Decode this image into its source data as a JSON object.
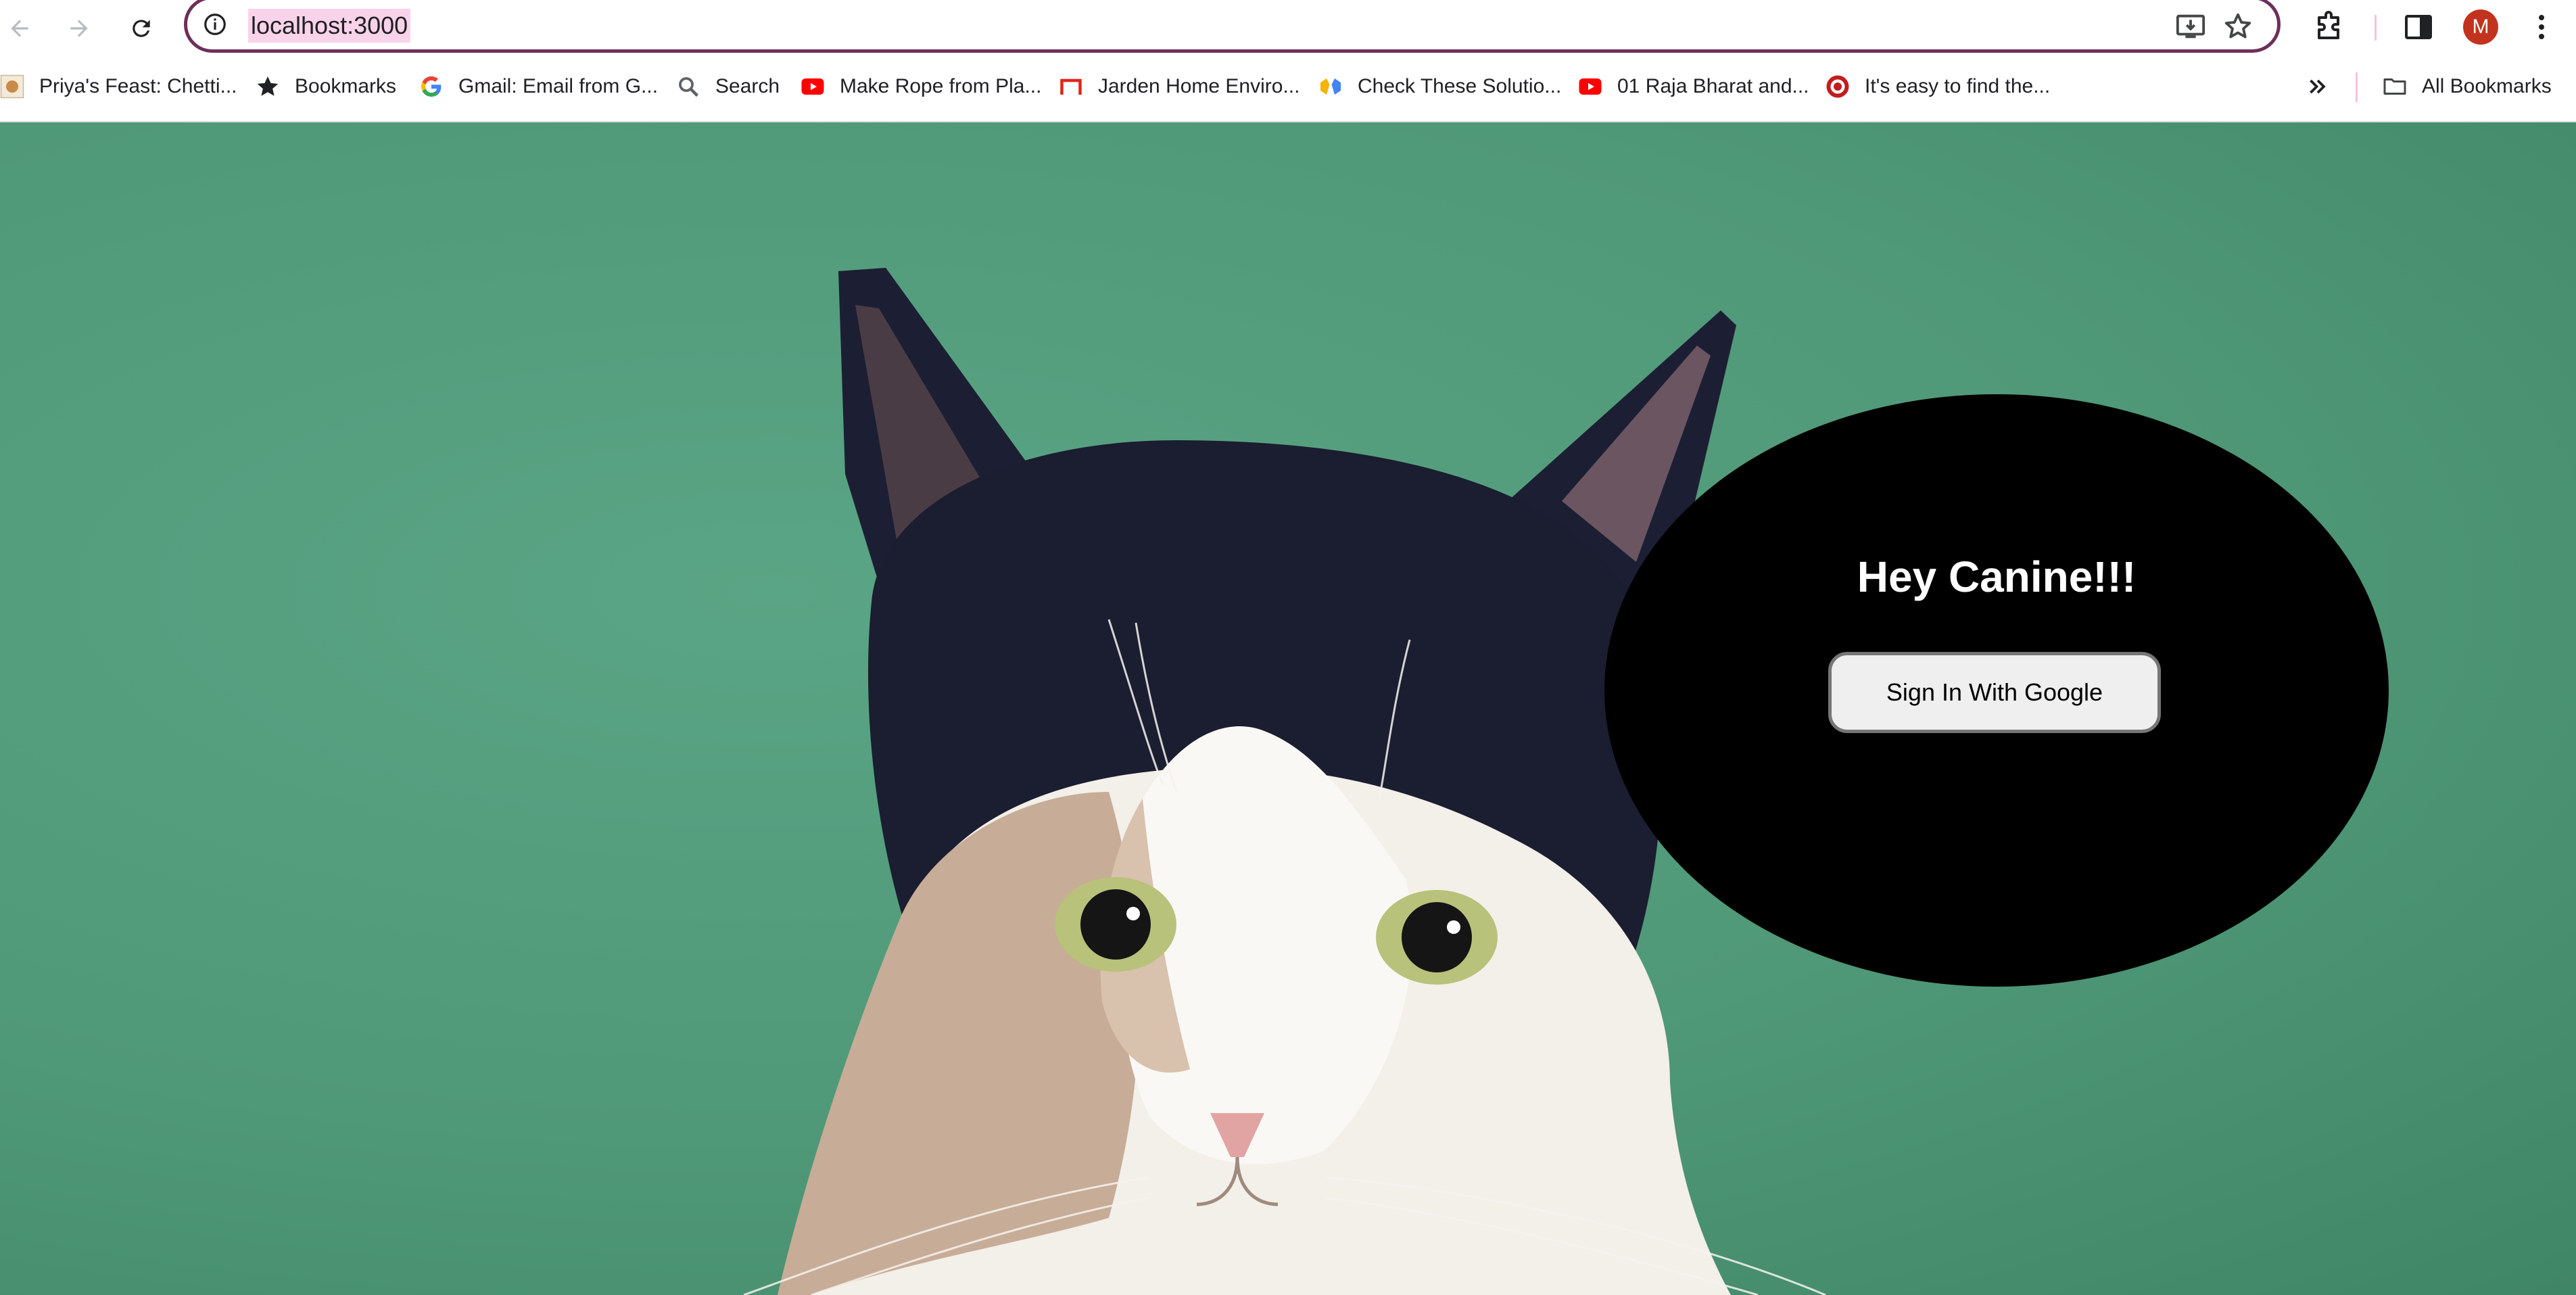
{
  "browser": {
    "url": "localhost:3000",
    "profile_initial": "M",
    "icons": [
      "back-icon",
      "forward-icon",
      "reload-icon",
      "info-icon",
      "install-app-icon",
      "star-icon",
      "extensions-icon",
      "side-panel-icon",
      "kebab-menu-icon"
    ],
    "accent": "#6d2f5b"
  },
  "bookmarks": {
    "items": [
      {
        "label": "Priya's Feast: Chetti...",
        "icon": "site-favicon"
      },
      {
        "label": "Bookmarks",
        "icon": "star-icon"
      },
      {
        "label": "Gmail: Email from G...",
        "icon": "google-icon"
      },
      {
        "label": "Search",
        "icon": "search-icon"
      },
      {
        "label": "Make Rope from Pla...",
        "icon": "youtube-icon"
      },
      {
        "label": "Jarden Home Enviro...",
        "icon": "jarden-icon"
      },
      {
        "label": "Check These Solutio...",
        "icon": "hands-icon"
      },
      {
        "label": "01 Raja Bharat and...",
        "icon": "youtube-icon"
      },
      {
        "label": "It's easy to find the...",
        "icon": "site-favicon"
      }
    ],
    "overflow_icon": "chevron-double-right-icon",
    "all_bookmarks_label": "All Bookmarks"
  },
  "page": {
    "greeting": "Hey Canine!!!",
    "signin_label": "Sign In With Google",
    "background_image": "cat-photo",
    "background_color": "#529e7e"
  }
}
